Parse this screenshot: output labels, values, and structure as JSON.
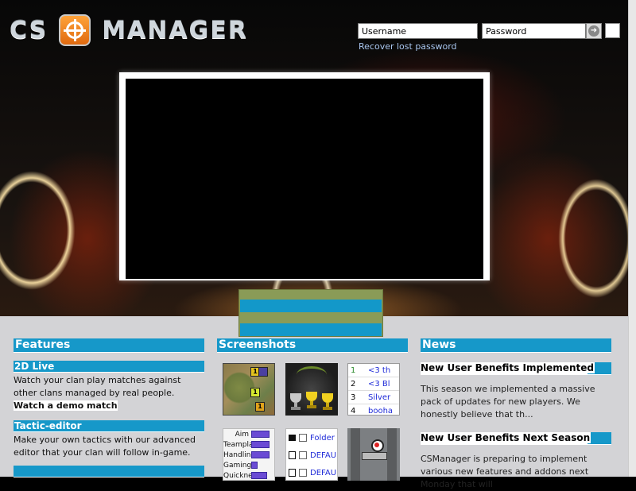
{
  "header": {
    "logo_left": "CS",
    "logo_right": "MANAGER",
    "username_placeholder": "Username",
    "password_placeholder": "Password",
    "recover_link": "Recover lost password"
  },
  "columns": {
    "features": {
      "title": "Features",
      "items": [
        {
          "title": "2D Live",
          "text": "Watch your clan play matches against other clans managed by real people. ",
          "link": "Watch a demo match"
        },
        {
          "title": "Tactic-editor",
          "text": "Make your own tactics with our advanced editor that your clan will follow in-game."
        }
      ]
    },
    "screenshots": {
      "title": "Screenshots",
      "ranking_rows": [
        {
          "no": "1",
          "name": "<3 th"
        },
        {
          "no": "2",
          "name": "<3 Bl"
        },
        {
          "no": "3",
          "name": "Silver"
        },
        {
          "no": "4",
          "name": "booha"
        }
      ],
      "stat_rows": [
        {
          "label": "Aim",
          "level": 0.7
        },
        {
          "label": "Teamplay:",
          "level": 0.7
        },
        {
          "label": "Handling:",
          "level": 0.7
        },
        {
          "label": "Gaming IQ:",
          "level": 0.2
        },
        {
          "label": "Quickness:",
          "level": 0.6
        }
      ],
      "folder_rows": [
        {
          "name": "Folder"
        },
        {
          "name": "DEFAU"
        },
        {
          "name": "DEFAU"
        }
      ],
      "map_flags": [
        "1",
        "1",
        "1"
      ]
    },
    "news": {
      "title": "News",
      "items": [
        {
          "title": "New User Benefits Implemented",
          "text": "This season we implemented a massive pack of updates for new players. We honestly believe that th..."
        },
        {
          "title": "New User Benefits Next Season",
          "text": "CSManager is preparing to implement various new features and addons next Monday that will"
        }
      ]
    }
  },
  "colors": {
    "accent_blue": "#1698c9",
    "panel_gray": "#d3d3d6",
    "tab_olive": "#8a9b57",
    "logo_orange": "#f08a20"
  }
}
